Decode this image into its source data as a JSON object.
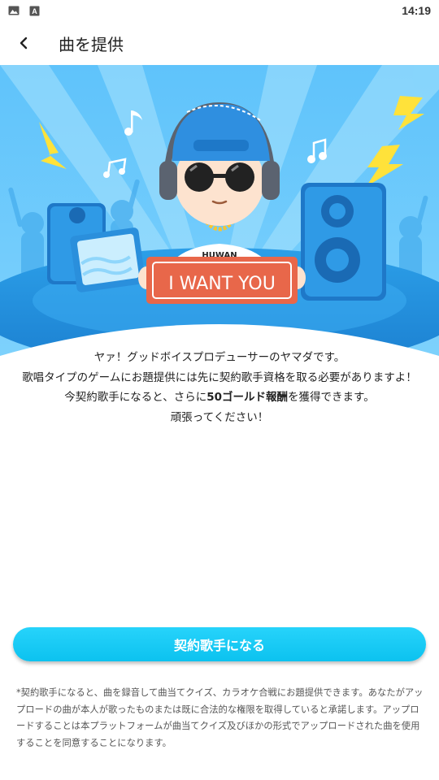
{
  "status_bar": {
    "time": "14:19",
    "icons": [
      "image-notification-icon",
      "font-notification-icon"
    ]
  },
  "app_bar": {
    "title": "曲を提供",
    "back_icon": "chevron-left-icon"
  },
  "hero": {
    "sign_text": "I WANT YOU",
    "shirt_text": "HUWAN"
  },
  "message": {
    "line1": "ヤァ！グッドボイスプロデューサーのヤマダです。",
    "line2": "歌唱タイプのゲームにお題提供には先に契約歌手資格を取る必要がありますよ！",
    "line3_before": "今契約歌手になると、さらに",
    "line3_bold": "50ゴールド報酬",
    "line3_after": "を獲得できます。",
    "line4": "頑張ってください！"
  },
  "cta_label": "契約歌手になる",
  "footnote": "*契約歌手になると、曲を録音して曲当てクイズ、カラオケ合戦にお題提供できます。あなたがアップロードの曲が本人が歌ったものまたは既に合法的な権限を取得していると承諾します。アップロードすることは本プラットフォームが曲当てクイズ及びほかの形式でアップロードされた曲を使用することを同意することになります。",
  "colors": {
    "accent": "#12c7f3",
    "sign": "#e8674a",
    "cap": "#2f8fe0"
  }
}
